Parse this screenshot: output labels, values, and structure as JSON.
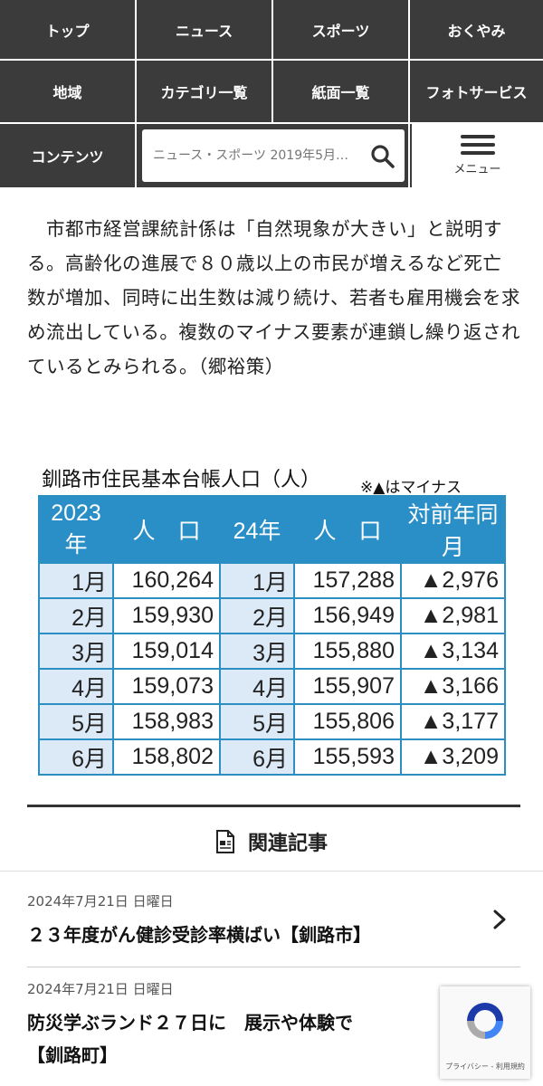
{
  "nav": {
    "items": [
      "トップ",
      "ニュース",
      "スポーツ",
      "おくやみ",
      "地域",
      "カテゴリ一覧",
      "紙面一覧",
      "フォトサービス",
      "コンテンツ"
    ],
    "search_placeholder": "ニュース・スポーツ 2019年5月…",
    "menu_label": "メニュー"
  },
  "article": {
    "paragraph": "　市都市経営課統計係は「自然現象が大きい」と説明する。高齢化の進展で８０歳以上の市民が増えるなど死亡数が増加、同時に出生数は減り続け、若者も雇用機会を求め流出している。複数のマイナス要素が連鎖し繰り返されているとみられる。（郷裕策）"
  },
  "table": {
    "title": "釧路市住民基本台帳人口（人）",
    "note": "※▲はマイナス",
    "headers": [
      "2023年",
      "人　口",
      "24年",
      "人　口",
      "対前年同月"
    ],
    "rows": [
      [
        "1月",
        "160,264",
        "1月",
        "157,288",
        "▲2,976"
      ],
      [
        "2月",
        "159,930",
        "2月",
        "156,949",
        "▲2,981"
      ],
      [
        "3月",
        "159,014",
        "3月",
        "155,880",
        "▲3,134"
      ],
      [
        "4月",
        "159,073",
        "4月",
        "155,907",
        "▲3,166"
      ],
      [
        "5月",
        "158,983",
        "5月",
        "155,806",
        "▲3,177"
      ],
      [
        "6月",
        "158,802",
        "6月",
        "155,593",
        "▲3,209"
      ]
    ]
  },
  "related": {
    "heading": "関連記事",
    "items": [
      {
        "date": "2024年7月21日 日曜日",
        "title": "２３年度がん健診受診率横ばい【釧路市】"
      },
      {
        "date": "2024年7月21日 日曜日",
        "title": "防災学ぶランド２７日に　展示や体験で",
        "title2": "【釧路町】"
      }
    ]
  },
  "recaptcha": {
    "label": "プライバシー - 利用規約"
  },
  "colors": {
    "nav_bg": "#3b3b3b",
    "table_header": "#2a8fc6",
    "table_month_bg": "#dce9f6"
  }
}
